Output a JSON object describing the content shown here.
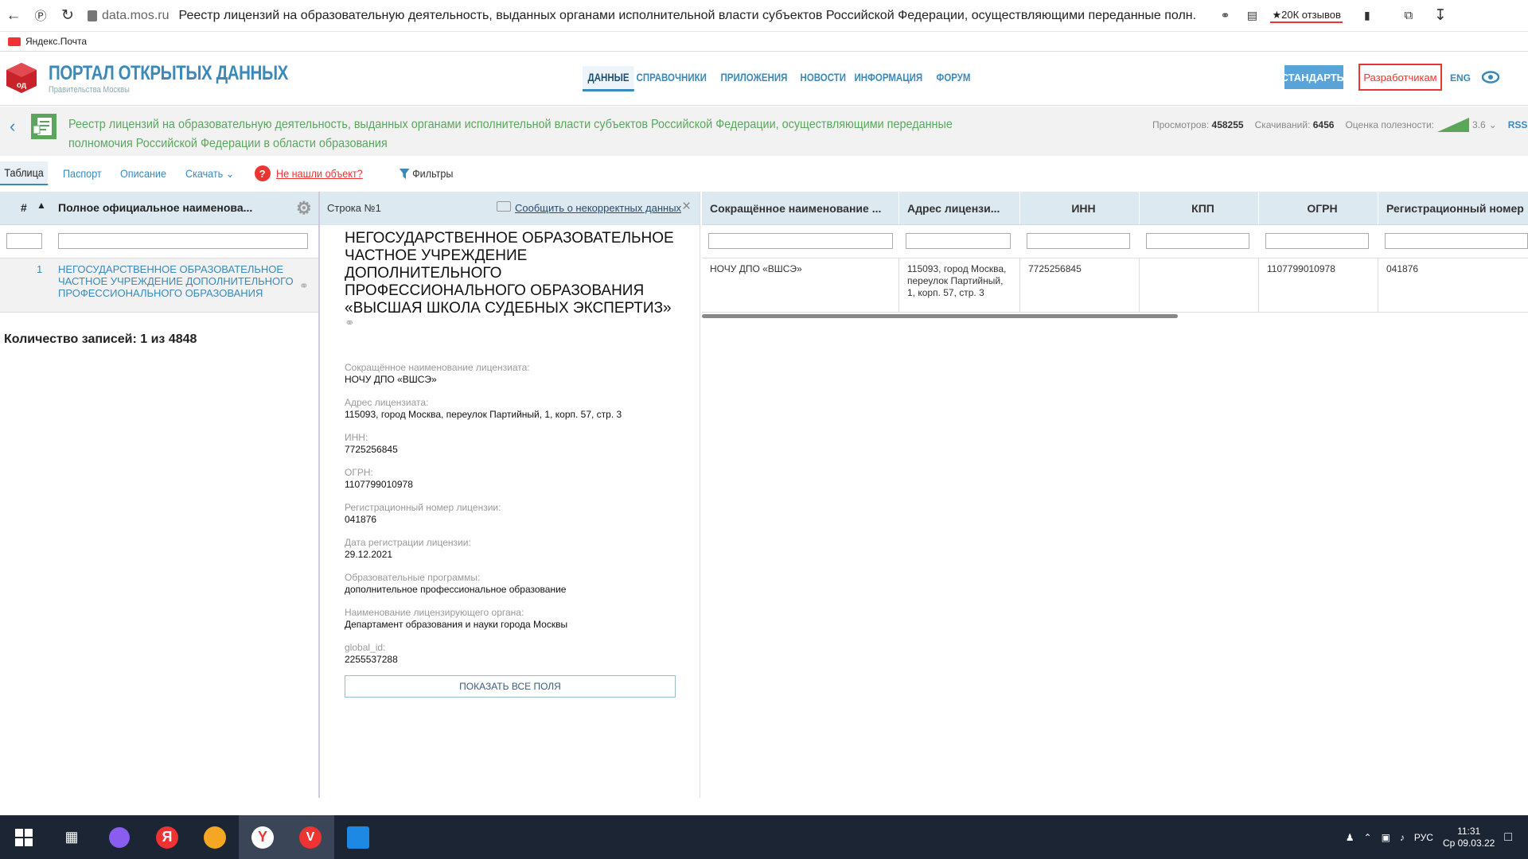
{
  "browser": {
    "host": "data.mos.ru",
    "title": "Реестр лицензий на образовательную деятельность, выданных органами исполнительной власти субъектов Российской Федерации, осуществляющими переданные полн...",
    "reviews": "★20К отзывов",
    "bookmark": "Яндекс.Почта"
  },
  "header": {
    "logo_title": "ПОРТАЛ ОТКРЫТЫХ ДАННЫХ",
    "logo_sub": "Правительства Москвы",
    "nav": [
      "ДАННЫЕ",
      "СПРАВОЧНИКИ",
      "ПРИЛОЖЕНИЯ",
      "НОВОСТИ",
      "ИНФОРМАЦИЯ",
      "ФОРУМ"
    ],
    "standards": "СТАНДАРТЫ",
    "developers": "Разработчикам",
    "lang": "ENG"
  },
  "dataset": {
    "title": "Реестр лицензий на образовательную деятельность, выданных органами исполнительной власти субъектов Российской Федерации, осуществляющими переданные полномочия Российской Федерации в области образования",
    "views_label": "Просмотров:",
    "views": "458255",
    "downloads_label": "Скачиваний:",
    "downloads": "6456",
    "rating_label": "Оценка полезности:",
    "rating": "3.6",
    "rss": "RSS"
  },
  "tabs": {
    "table": "Таблица",
    "passport": "Паспорт",
    "description": "Описание",
    "download": "Скачать",
    "notfound_badge": "?",
    "notfound": "Не нашли объект?",
    "filters": "Фильтры"
  },
  "left_table": {
    "col_num": "#",
    "col_name": "Полное официальное наименова...",
    "rows": [
      {
        "num": "1",
        "name": "НЕГОСУДАРСТВЕННОЕ ОБРАЗОВАТЕЛЬНОЕ ЧАСТНОЕ УЧРЕЖДЕНИЕ ДОПОЛНИТЕЛЬНОГО ПРОФЕССИОНАЛЬНОГО ОБРАЗОВАНИЯ"
      }
    ],
    "count": "Количество записей: 1 из 4848"
  },
  "detail": {
    "row_label": "Строка №1",
    "report": "Сообщить о некорректных данных",
    "title": "НЕГОСУДАРСТВЕННОЕ ОБРАЗОВАТЕЛЬНОЕ ЧАСТНОЕ УЧРЕЖДЕНИЕ ДОПОЛНИТЕЛЬНОГО ПРОФЕССИОНАЛЬНОГО ОБРАЗОВАНИЯ «ВЫСШАЯ ШКОЛА СУДЕБНЫХ ЭКСПЕРТИЗ»",
    "fields": [
      {
        "label": "Сокращённое наименование лицензиата:",
        "value": "НОЧУ ДПО «ВШСЭ»"
      },
      {
        "label": "Адрес лицензиата:",
        "value": "115093, город Москва, переулок Партийный, 1, корп. 57, стр. 3"
      },
      {
        "label": "ИНН:",
        "value": "7725256845"
      },
      {
        "label": "ОГРН:",
        "value": "1107799010978"
      },
      {
        "label": "Регистрационный номер лицензии:",
        "value": "041876"
      },
      {
        "label": "Дата регистрации лицензии:",
        "value": "29.12.2021"
      },
      {
        "label": "Образовательные программы:",
        "value": "дополнительное профессиональное образование"
      },
      {
        "label": "Наименование лицензирующего органа:",
        "value": "Департамент образования и науки города Москвы"
      },
      {
        "label": "global_id:",
        "value": "2255537288"
      }
    ],
    "show_all": "ПОКАЗАТЬ ВСЕ ПОЛЯ"
  },
  "right_table": {
    "headers": [
      "Сокращённое наименование ...",
      "Адрес лицензи...",
      "ИНН",
      "КПП",
      "ОГРН",
      "Регистрационный номер"
    ],
    "row": [
      "НОЧУ ДПО «ВШСЭ»",
      "115093, город Москва, переулок Партийный, 1, корп. 57, стр. 3",
      "7725256845",
      "",
      "1107799010978",
      "041876"
    ]
  },
  "taskbar": {
    "lang": "РУС",
    "time": "11:31",
    "date": "Ср 09.03.22"
  }
}
